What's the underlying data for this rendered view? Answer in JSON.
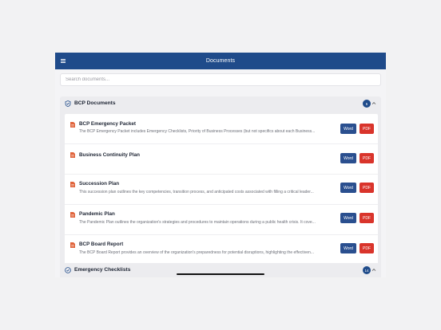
{
  "header": {
    "title": "Documents",
    "menu_icon": "hamburger-menu-icon"
  },
  "search": {
    "placeholder": "Search documents..."
  },
  "colors": {
    "header_bg": "#1f4b8a",
    "word_button": "#2a4f8f",
    "pdf_button": "#d9342b",
    "doc_icon": "#e0643c"
  },
  "sections": [
    {
      "title": "BCP Documents",
      "icon": "shield-check-icon",
      "count": "5",
      "expanded": true,
      "documents": [
        {
          "title": "BCP Emergency Packet",
          "description": "The BCP Emergency Packet includes Emergency Checklists, Priority of Business Processes (but not specifics about each Business...",
          "word_label": "Word",
          "pdf_label": "PDF"
        },
        {
          "title": "Business Continuity Plan",
          "description": "",
          "word_label": "Word",
          "pdf_label": "PDF"
        },
        {
          "title": "Succession Plan",
          "description": "This succession plan outlines the key competencies, transition process, and anticipated costs associated with filling a critical leader...",
          "word_label": "Word",
          "pdf_label": "PDF"
        },
        {
          "title": "Pandemic Plan",
          "description": "The Pandemic Plan outlines the organization's strategies and procedures to maintain operations during a public health crisis. It cove...",
          "word_label": "Word",
          "pdf_label": "PDF"
        },
        {
          "title": "BCP Board Report",
          "description": "The BCP Board Report provides an overview of the organization's preparedness for potential disruptions, highlighting the effectiven...",
          "word_label": "Word",
          "pdf_label": "PDF"
        }
      ]
    },
    {
      "title": "Emergency Checklists",
      "icon": "check-circle-icon",
      "count": "14",
      "expanded": true,
      "documents": []
    }
  ]
}
